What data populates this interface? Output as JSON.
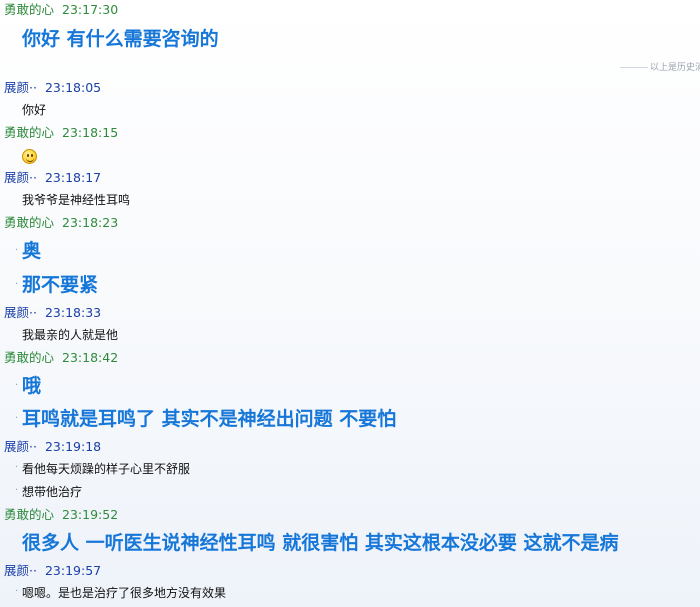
{
  "history_label": "以上是历史消",
  "messages": [
    {
      "sender": "勇敢的心",
      "time": "23:17:30"
    },
    {
      "sender": "展颜··",
      "time": "23:18:05"
    },
    {
      "sender": "勇敢的心",
      "time": "23:18:15"
    },
    {
      "sender": "展颜··",
      "time": "23:18:17"
    },
    {
      "sender": "勇敢的心",
      "time": "23:18:23"
    },
    {
      "sender": "展颜··",
      "time": "23:18:33"
    },
    {
      "sender": "勇敢的心",
      "time": "23:18:42"
    },
    {
      "sender": "展颜··",
      "time": "23:19:18"
    },
    {
      "sender": "勇敢的心",
      "time": "23:19:52"
    },
    {
      "sender": "展颜··",
      "time": "23:19:57"
    }
  ],
  "lines": {
    "m0_0": "你好  有什么需要咨询的",
    "m1_0": "你好",
    "m2_emoji": "smile-emoji-icon",
    "m3_0": "我爷爷是神经性耳鸣",
    "m4_0": "奥",
    "m4_1": "那不要紧",
    "m5_0": "我最亲的人就是他",
    "m6_0": "哦",
    "m6_1": "耳鸣就是耳鸣了   其实不是神经出问题   不要怕",
    "m7_0": "看他每天烦躁的样子心里不舒服",
    "m7_1": "想带他治疗",
    "m8_0": "很多人   一听医生说神经性耳鸣    就很害怕  其实这根本没必要    这就不是病",
    "m9_0": "嗯嗯。是也是治疗了很多地方没有效果"
  },
  "colors": {
    "self": "#2e8b3c",
    "peer": "#1a3fa8",
    "big_text": "#1677d8"
  }
}
